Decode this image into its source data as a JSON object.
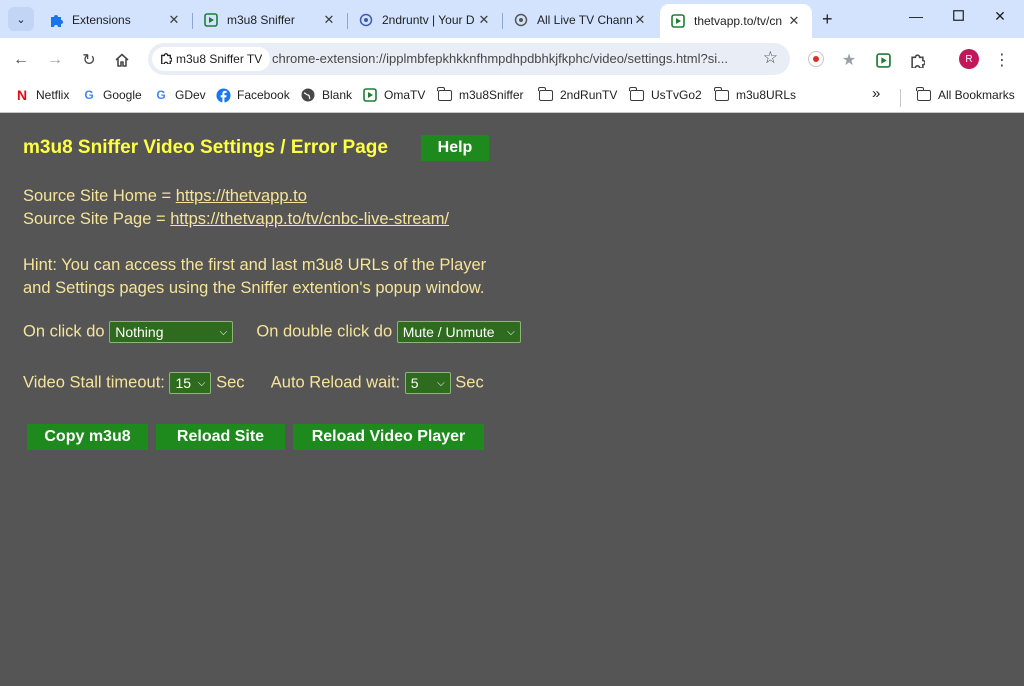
{
  "browser": {
    "tabs": [
      {
        "title": "Extensions",
        "icon": "puzzle-icon"
      },
      {
        "title": "m3u8 Sniffer",
        "icon": "play-icon"
      },
      {
        "title": "2ndruntv | Your D",
        "icon": "globe-icon"
      },
      {
        "title": "All Live TV Chann",
        "icon": "globe-icon"
      },
      {
        "title": "thetvapp.to/tv/cn",
        "icon": "play-icon",
        "active": true
      }
    ],
    "new_tab_label": "+",
    "omnibox": {
      "chip_label": "m3u8 Sniffer TV",
      "url": "chrome-extension://ipplmbfepkhkknfhmpdhpdbhkjfkphc/video/settings.html?si..."
    },
    "avatar_letter": "R",
    "bookmarks": [
      {
        "label": "Netflix",
        "icon": "netflix-icon"
      },
      {
        "label": "Google",
        "icon": "google-icon"
      },
      {
        "label": "GDev",
        "icon": "google-icon"
      },
      {
        "label": "Facebook",
        "icon": "facebook-icon"
      },
      {
        "label": "Blank",
        "icon": "globe-icon"
      },
      {
        "label": "OmaTV",
        "icon": "play-icon"
      },
      {
        "label": "m3u8Sniffer",
        "icon": "folder-icon"
      },
      {
        "label": "2ndRunTV",
        "icon": "folder-icon"
      },
      {
        "label": "UsTvGo2",
        "icon": "folder-icon"
      },
      {
        "label": "m3u8URLs",
        "icon": "folder-icon"
      }
    ],
    "bookmarks_overflow": "»",
    "all_bookmarks_label": "All Bookmarks"
  },
  "page": {
    "heading": "m3u8 Sniffer Video Settings / Error Page",
    "help_label": "Help",
    "source_home_prefix": "Source Site Home = ",
    "source_home_url": "https://thetvapp.to",
    "source_page_prefix": "Source Site Page = ",
    "source_page_url": "https://thetvapp.to/tv/cnbc-live-stream/",
    "hint_line1": "Hint: You can access the first and last m3u8 URLs of the Player",
    "hint_line2": "and Settings pages using the Sniffer extention's popup window.",
    "on_click_label": "On click do",
    "on_click_value": "Nothing",
    "on_double_click_label": "On double click do",
    "on_double_click_value": "Mute / Unmute",
    "stall_label": "Video Stall timeout:",
    "stall_value": "15",
    "stall_unit": "Sec",
    "reload_wait_label": "Auto Reload wait:",
    "reload_wait_value": "5",
    "reload_wait_unit": "Sec",
    "buttons": {
      "copy": "Copy m3u8",
      "reload_site": "Reload Site",
      "reload_player": "Reload Video Player"
    }
  },
  "colors": {
    "page_bg": "#555555",
    "heading": "#ffff44",
    "text": "#f6e49a",
    "button_green": "#1e8a1e"
  }
}
